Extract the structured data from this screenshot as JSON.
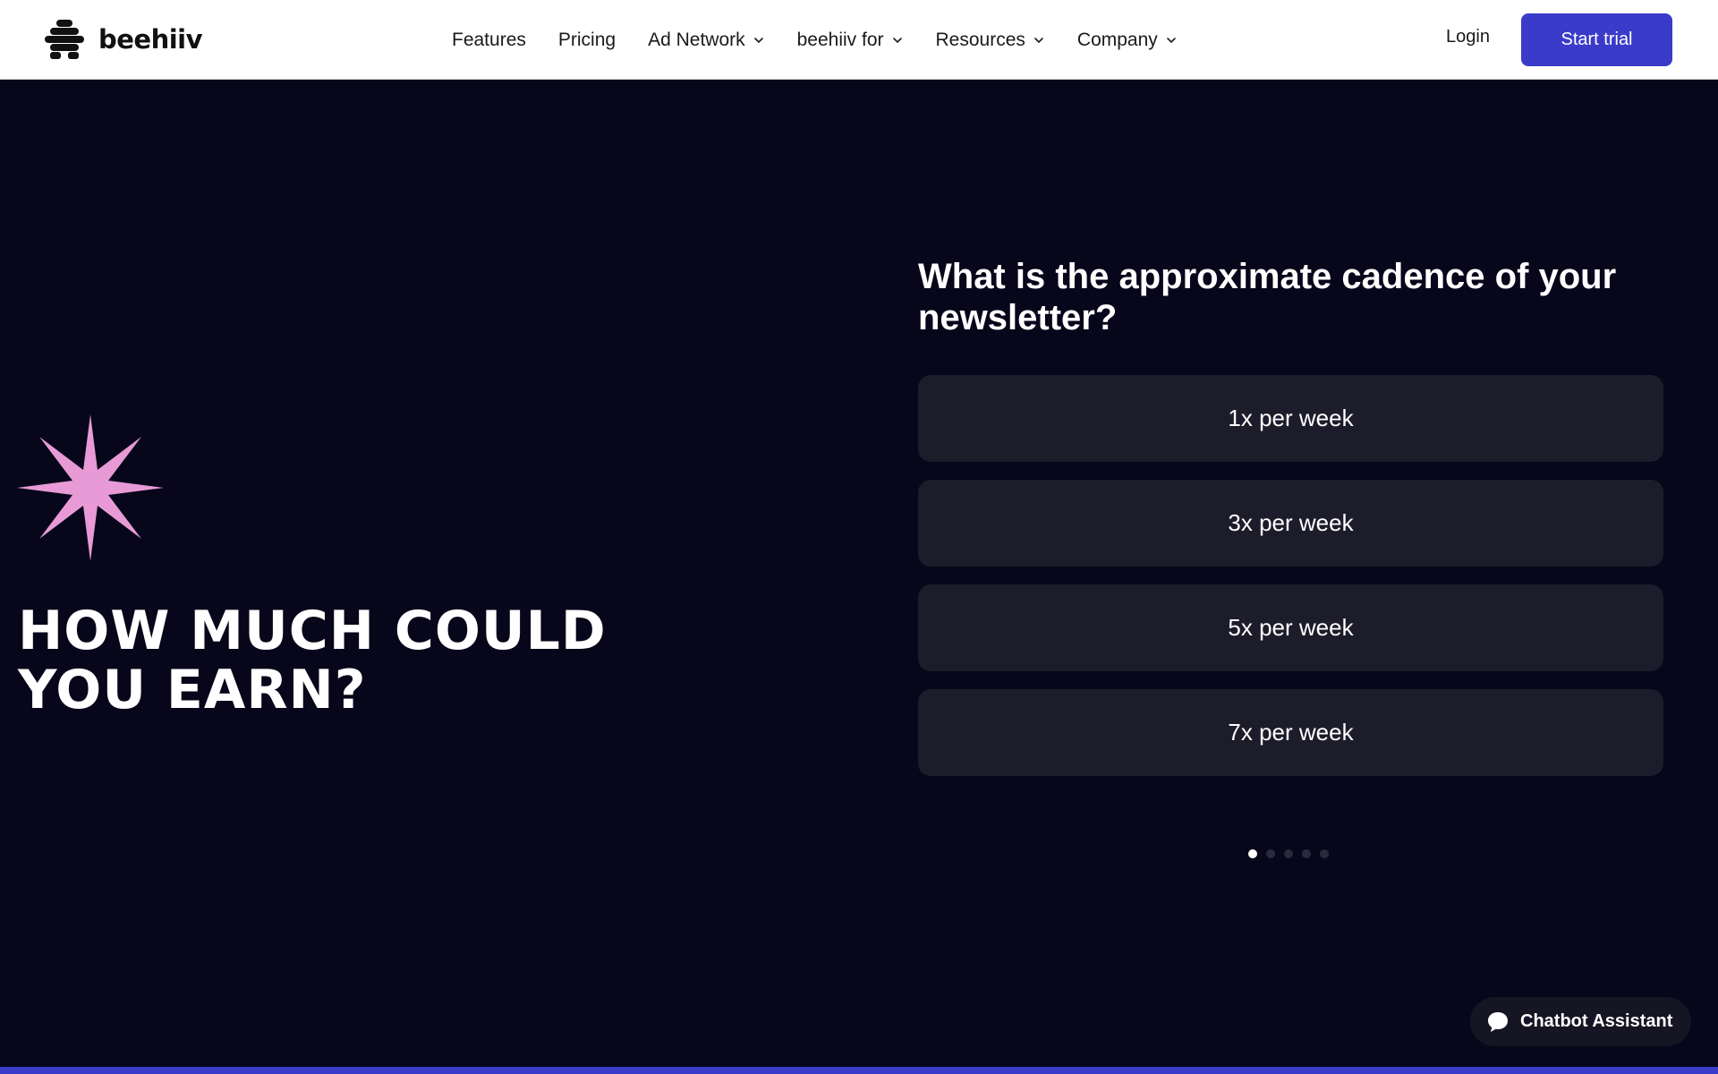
{
  "header": {
    "logo_text": "beehiiv",
    "nav": [
      {
        "label": "Features",
        "dropdown": false
      },
      {
        "label": "Pricing",
        "dropdown": false
      },
      {
        "label": "Ad Network",
        "dropdown": true
      },
      {
        "label": "beehiiv for",
        "dropdown": true
      },
      {
        "label": "Resources",
        "dropdown": true
      },
      {
        "label": "Company",
        "dropdown": true
      }
    ],
    "login_label": "Login",
    "cta_label": "Start trial"
  },
  "hero": {
    "headline_line1": "HOW MUCH COULD",
    "headline_line2": "YOU EARN?",
    "star_icon": "sparkle-star-icon"
  },
  "quiz": {
    "question": "What is the approximate cadence of your newsletter?",
    "options": [
      "1x per week",
      "3x per week",
      "5x per week",
      "7x per week"
    ],
    "steps_total": 5,
    "current_step": 1
  },
  "chatbot": {
    "label": "Chatbot Assistant",
    "icon": "chat-bubble-icon"
  },
  "colors": {
    "background": "#07061a",
    "accent": "#3a3bc9",
    "star": "#e89ad6",
    "option_bg": "#1d1c2b"
  }
}
